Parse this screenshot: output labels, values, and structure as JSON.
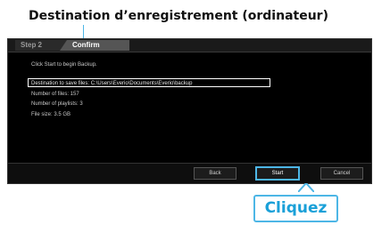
{
  "annotations": {
    "top_label": "Destination d’enregistrement (ordinateur)",
    "click_label": "Cliquez",
    "accent_color": "#4db6e6"
  },
  "dialog": {
    "tabs": [
      {
        "label": "Step 2"
      },
      {
        "label": "Confirm"
      }
    ],
    "lines": [
      "Click Start to begin Backup.",
      "Destination to save files: C:\\Users\\Everio\\Documents\\Everio\\backup",
      "Number of files: 157",
      "Number of playlists: 3",
      "File size: 3.5 GB"
    ],
    "buttons": {
      "back": "Back",
      "start": "Start",
      "cancel": "Cancel"
    }
  }
}
